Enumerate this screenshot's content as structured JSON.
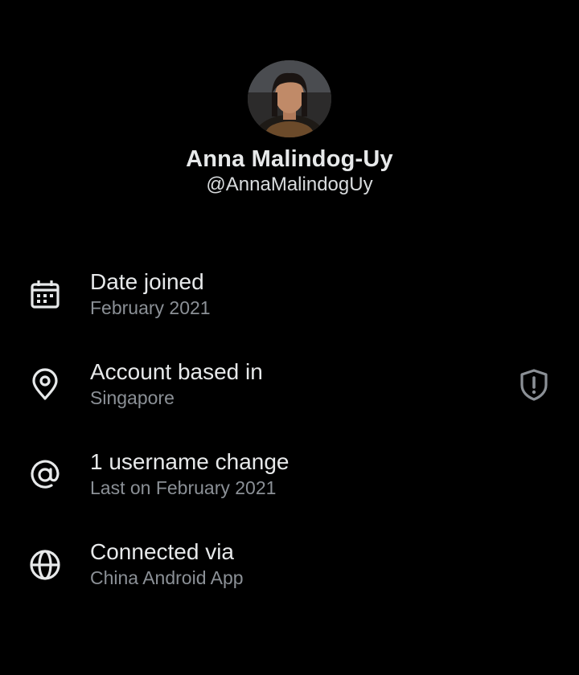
{
  "profile": {
    "name": "Anna Malindog-Uy",
    "handle": "@AnnaMalindogUy"
  },
  "rows": [
    {
      "icon": "calendar-icon",
      "title": "Date joined",
      "subtitle": "February 2021"
    },
    {
      "icon": "location-pin-icon",
      "title": "Account based in",
      "subtitle": "Singapore",
      "badge_icon": "shield-alert-icon"
    },
    {
      "icon": "at-sign-icon",
      "title": "1 username change",
      "subtitle": "Last on February 2021"
    },
    {
      "icon": "globe-icon",
      "title": "Connected via",
      "subtitle": "China Android App"
    }
  ],
  "colors": {
    "background": "#000000",
    "primary_text": "#e7e9ea",
    "secondary_text": "#8b9096"
  }
}
